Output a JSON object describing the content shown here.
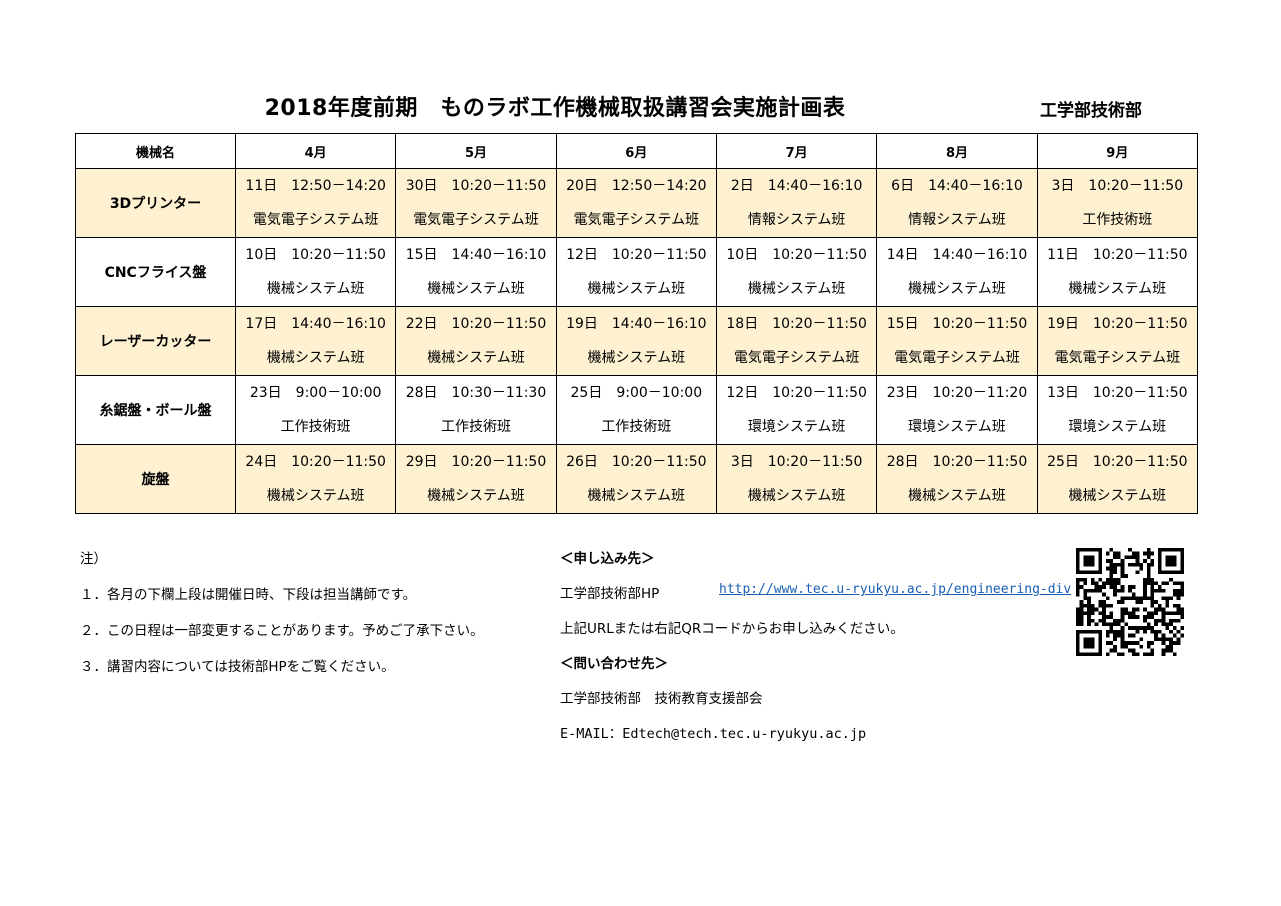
{
  "title": "2018年度前期　ものラボ工作機械取扱講習会実施計画表",
  "org": "工学部技術部",
  "table": {
    "headers": [
      "機械名",
      "4月",
      "5月",
      "6月",
      "7月",
      "8月",
      "9月"
    ],
    "rows": [
      {
        "machine": "3Dプリンター",
        "cells": [
          {
            "date": "11日　12:50－14:20",
            "group": "電気電子システム班"
          },
          {
            "date": "30日　10:20－11:50",
            "group": "電気電子システム班"
          },
          {
            "date": "20日　12:50－14:20",
            "group": "電気電子システム班"
          },
          {
            "date": "2日　14:40－16:10",
            "group": "情報システム班"
          },
          {
            "date": "6日　14:40－16:10",
            "group": "情報システム班"
          },
          {
            "date": "3日　10:20－11:50",
            "group": "工作技術班"
          }
        ]
      },
      {
        "machine": "CNCフライス盤",
        "cells": [
          {
            "date": "10日　10:20－11:50",
            "group": "機械システム班"
          },
          {
            "date": "15日　14:40－16:10",
            "group": "機械システム班"
          },
          {
            "date": "12日　10:20－11:50",
            "group": "機械システム班"
          },
          {
            "date": "10日　10:20－11:50",
            "group": "機械システム班"
          },
          {
            "date": "14日　14:40－16:10",
            "group": "機械システム班"
          },
          {
            "date": "11日　10:20－11:50",
            "group": "機械システム班"
          }
        ]
      },
      {
        "machine": "レーザーカッター",
        "cells": [
          {
            "date": "17日　14:40－16:10",
            "group": "機械システム班"
          },
          {
            "date": "22日　10:20－11:50",
            "group": "機械システム班"
          },
          {
            "date": "19日　14:40－16:10",
            "group": "機械システム班"
          },
          {
            "date": "18日　10:20－11:50",
            "group": "電気電子システム班"
          },
          {
            "date": "15日　10:20－11:50",
            "group": "電気電子システム班"
          },
          {
            "date": "19日　10:20－11:50",
            "group": "電気電子システム班"
          }
        ]
      },
      {
        "machine": "糸鋸盤・ボール盤",
        "cells": [
          {
            "date": "23日　9:00－10:00",
            "group": "工作技術班"
          },
          {
            "date": "28日　10:30－11:30",
            "group": "工作技術班"
          },
          {
            "date": "25日　9:00－10:00",
            "group": "工作技術班"
          },
          {
            "date": "12日　10:20－11:50",
            "group": "環境システム班"
          },
          {
            "date": "23日　10:20－11:20",
            "group": "環境システム班"
          },
          {
            "date": "13日　10:20－11:50",
            "group": "環境システム班"
          }
        ]
      },
      {
        "machine": "旋盤",
        "cells": [
          {
            "date": "24日　10:20－11:50",
            "group": "機械システム班"
          },
          {
            "date": "29日　10:20－11:50",
            "group": "機械システム班"
          },
          {
            "date": "26日　10:20－11:50",
            "group": "機械システム班"
          },
          {
            "date": "3日　10:20－11:50",
            "group": "機械システム班"
          },
          {
            "date": "28日　10:20－11:50",
            "group": "機械システム班"
          },
          {
            "date": "25日　10:20－11:50",
            "group": "機械システム班"
          }
        ]
      }
    ]
  },
  "notes": {
    "heading": "注）",
    "items": [
      "１．各月の下欄上段は開催日時、下段は担当講師です。",
      "２．この日程は一部変更することがあります。予めご了承下さい。",
      "３．講習内容については技術部HPをご覧ください。"
    ]
  },
  "contact": {
    "apply_heading": "＜申し込み先＞",
    "hp_label": "工学部技術部HP",
    "hp_url": "http://www.tec.u-ryukyu.ac.jp/engineering-div",
    "apply_text": "上記URLまたは右記QRコードからお申し込みください。",
    "inquiry_heading": "＜問い合わせ先＞",
    "inquiry_org": "工学部技術部　技術教育支援部会",
    "email": "E-MAIL：Edtech@tech.tec.u-ryukyu.ac.jp"
  },
  "qr_code": "qr-code-icon"
}
